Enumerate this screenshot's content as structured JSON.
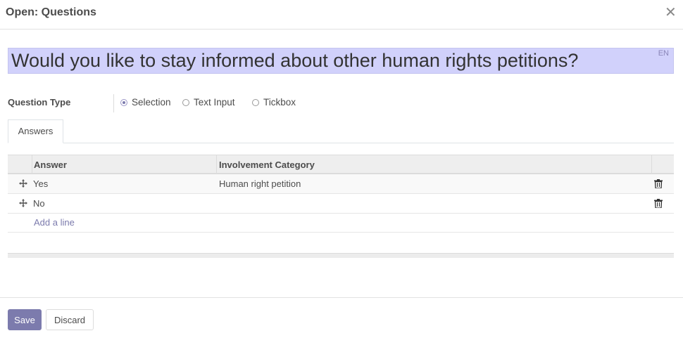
{
  "dialog": {
    "title": "Open: Questions",
    "close_icon": "close-icon"
  },
  "question": {
    "text": "Would you like to stay informed about other human rights petitions?",
    "lang_badge": "EN",
    "highlight_color": "#d1d1fb"
  },
  "question_type": {
    "label": "Question Type",
    "options": [
      {
        "label": "Selection",
        "selected": true
      },
      {
        "label": "Text Input",
        "selected": false
      },
      {
        "label": "Tickbox",
        "selected": false
      }
    ]
  },
  "tabs": [
    {
      "label": "Answers",
      "active": true
    }
  ],
  "answers_table": {
    "columns": [
      "Answer",
      "Involvement Category"
    ],
    "rows": [
      {
        "answer": "Yes",
        "involvement_category": "Human right petition"
      },
      {
        "answer": "No",
        "involvement_category": ""
      }
    ],
    "add_line_label": "Add a line",
    "row_icons": {
      "drag": "move-icon",
      "delete": "trash-icon"
    }
  },
  "footer": {
    "save_label": "Save",
    "discard_label": "Discard"
  },
  "colors": {
    "accent": "#7c7bad"
  }
}
